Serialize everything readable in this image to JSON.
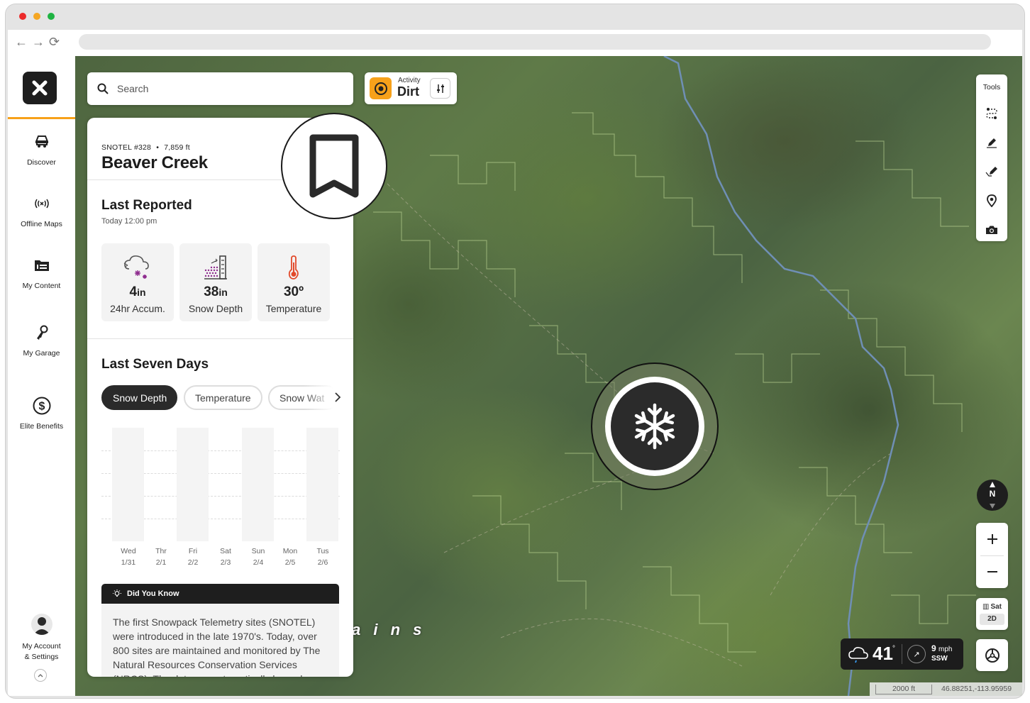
{
  "sidebar": {
    "items": [
      {
        "label": "Discover",
        "icon": "jeep-icon"
      },
      {
        "label": "Offline Maps",
        "icon": "broadcast-icon"
      },
      {
        "label": "My Content",
        "icon": "folder-icon"
      },
      {
        "label": "My Garage",
        "icon": "keys-icon"
      },
      {
        "label": "Elite Benefits",
        "icon": "dollar-icon"
      }
    ],
    "account_label_1": "My Account",
    "account_label_2": "& Settings"
  },
  "search": {
    "placeholder": "Search"
  },
  "activity": {
    "small_label": "Activity",
    "value": "Dirt"
  },
  "panel": {
    "subtitle_id": "SNOTEL #328",
    "subtitle_sep": "•",
    "subtitle_elev": "7,859 ft",
    "title": "Beaver Creek",
    "last_reported_title": "Last Reported",
    "last_reported_time": "Today 12:00 pm",
    "stats": [
      {
        "value": "4",
        "unit": "in",
        "label": "24hr Accum."
      },
      {
        "value": "38",
        "unit": "in",
        "label": "Snow Depth"
      },
      {
        "value": "30º",
        "unit": "",
        "label": "Temperature"
      }
    ],
    "seven_days_title": "Last Seven Days",
    "tabs": [
      "Snow Depth",
      "Temperature",
      "Snow Wat"
    ],
    "days": [
      {
        "day": "Wed",
        "date": "1/31"
      },
      {
        "day": "Thr",
        "date": "2/1"
      },
      {
        "day": "Fri",
        "date": "2/2"
      },
      {
        "day": "Sat",
        "date": "2/3"
      },
      {
        "day": "Sun",
        "date": "2/4"
      },
      {
        "day": "Mon",
        "date": "2/5"
      },
      {
        "day": "Tus",
        "date": "2/6"
      }
    ],
    "did_you_know_title": "Did You Know",
    "did_you_know_text": "The first Snowpack Telemetry sites (SNOTEL) were introduced in the late 1970's. Today, over 800 sites are maintained and monitored by The Natural Resources Conservation Services (NRCS). The data are automatically logged."
  },
  "map": {
    "label_text": "a i n s",
    "tools_label": "Tools",
    "compass_label": "N",
    "layer_label": "Sat",
    "layer_mode": "2D",
    "weather_temp": "41",
    "weather_deg": "°",
    "wind_speed": "9",
    "wind_unit": "mph",
    "wind_dir": "SSW",
    "scale": "2000 ft",
    "coords": "46.88251,-113.95959"
  },
  "colors": {
    "accent": "#f7a11a",
    "dark": "#1e1e1e",
    "snow_purple": "#8e2b8e",
    "temp_red": "#e24a2b"
  }
}
